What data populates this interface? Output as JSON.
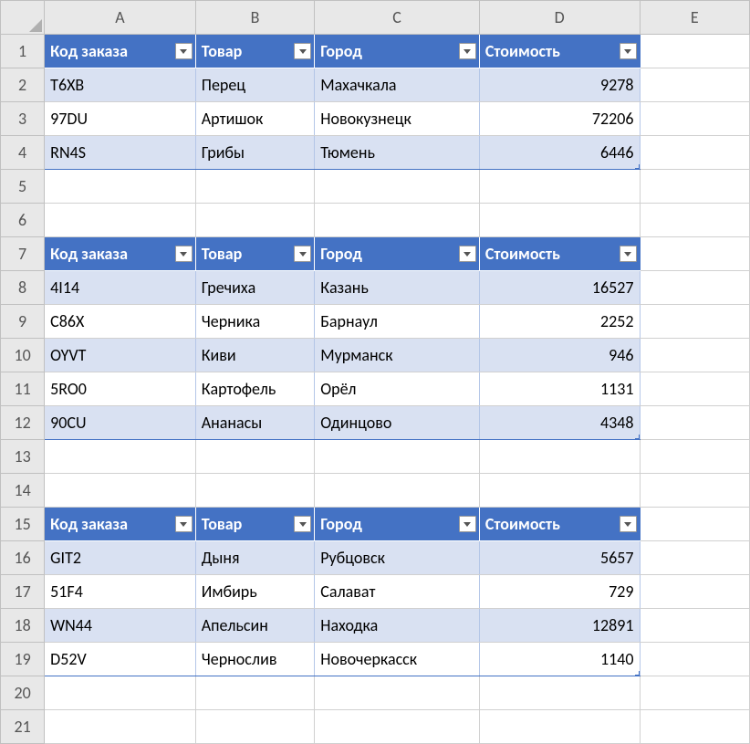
{
  "columns": [
    "A",
    "B",
    "C",
    "D",
    "E"
  ],
  "row_count": 21,
  "headers": {
    "code": "Код заказа",
    "product": "Товар",
    "city": "Город",
    "cost": "Стоимость"
  },
  "tables": [
    {
      "header_row": 1,
      "rows": [
        {
          "band": "light",
          "code": "T6XB",
          "product": "Перец",
          "city": "Махачкала",
          "cost": "9278"
        },
        {
          "band": "white",
          "code": "97DU",
          "product": "Артишок",
          "city": "Новокузнецк",
          "cost": "72206"
        },
        {
          "band": "light",
          "code": "RN4S",
          "product": "Грибы",
          "city": "Тюмень",
          "cost": "6446"
        }
      ]
    },
    {
      "header_row": 7,
      "rows": [
        {
          "band": "light",
          "code": "4I14",
          "product": "Гречиха",
          "city": "Казань",
          "cost": "16527"
        },
        {
          "band": "white",
          "code": "C86X",
          "product": "Черника",
          "city": "Барнаул",
          "cost": "2252"
        },
        {
          "band": "light",
          "code": "OYVT",
          "product": "Киви",
          "city": "Мурманск",
          "cost": "946"
        },
        {
          "band": "white",
          "code": "5RO0",
          "product": "Картофель",
          "city": "Орёл",
          "cost": "1131"
        },
        {
          "band": "light",
          "code": "90CU",
          "product": "Ананасы",
          "city": "Одинцово",
          "cost": "4348"
        }
      ]
    },
    {
      "header_row": 15,
      "rows": [
        {
          "band": "light",
          "code": "GIT2",
          "product": "Дыня",
          "city": "Рубцовск",
          "cost": "5657"
        },
        {
          "band": "white",
          "code": "51F4",
          "product": "Имбирь",
          "city": "Салават",
          "cost": "729"
        },
        {
          "band": "light",
          "code": "WN44",
          "product": "Апельсин",
          "city": "Находка",
          "cost": "12891"
        },
        {
          "band": "white",
          "code": "D52V",
          "product": "Чернослив",
          "city": "Новочеркасск",
          "cost": "1140"
        }
      ]
    }
  ]
}
